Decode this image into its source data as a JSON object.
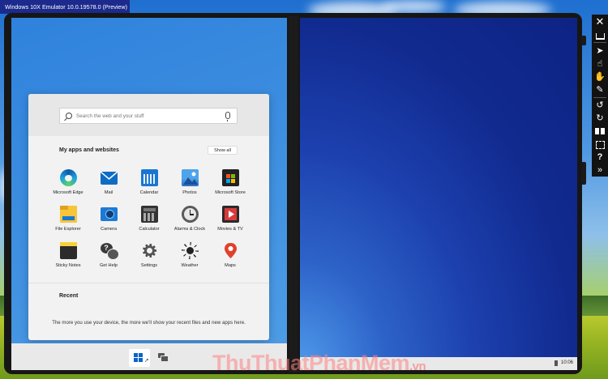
{
  "window": {
    "title": "Windows 10X Emulator 10.0.19578.0 (Preview)"
  },
  "start_menu": {
    "search_placeholder": "Search the web and your stuff",
    "apps_section_title": "My apps and websites",
    "show_all_label": "Show all",
    "apps": [
      {
        "label": "Microsoft Edge",
        "icon": "microsoft-edge-icon"
      },
      {
        "label": "Mail",
        "icon": "mail-icon"
      },
      {
        "label": "Calendar",
        "icon": "calendar-icon"
      },
      {
        "label": "Photos",
        "icon": "photos-icon"
      },
      {
        "label": "Microsoft Store",
        "icon": "microsoft-store-icon"
      },
      {
        "label": "File Explorer",
        "icon": "file-explorer-icon"
      },
      {
        "label": "Camera",
        "icon": "camera-icon"
      },
      {
        "label": "Calculator",
        "icon": "calculator-icon"
      },
      {
        "label": "Alarms & Clock",
        "icon": "alarms-clock-icon"
      },
      {
        "label": "Movies & TV",
        "icon": "movies-tv-icon"
      },
      {
        "label": "Sticky Notes",
        "icon": "sticky-notes-icon"
      },
      {
        "label": "Get Help",
        "icon": "get-help-icon"
      },
      {
        "label": "Settings",
        "icon": "settings-gear-icon"
      },
      {
        "label": "Weather",
        "icon": "weather-sun-icon"
      },
      {
        "label": "Maps",
        "icon": "maps-pin-icon"
      }
    ],
    "recent_title": "Recent",
    "recent_message": "The more you use your device, the more we'll show your recent files and new apps here."
  },
  "taskbar": {
    "clock": "10:06"
  },
  "toolbar": {
    "buttons": [
      "close-icon",
      "minimize-icon",
      "mouse-input-icon",
      "touch-input-icon",
      "pen-input-icon",
      "rotate-left-icon",
      "rotate-right-icon",
      "dual-screen-icon",
      "zoom-fit-icon",
      "help-icon",
      "more-tools-icon"
    ]
  },
  "watermark": {
    "text": "ThuThuatPhanMem",
    "suffix": ".vn"
  },
  "colors": {
    "accent": "#0a64c8",
    "title_bar": "#1b2a8c",
    "start_panel": "#f2f2f2"
  }
}
